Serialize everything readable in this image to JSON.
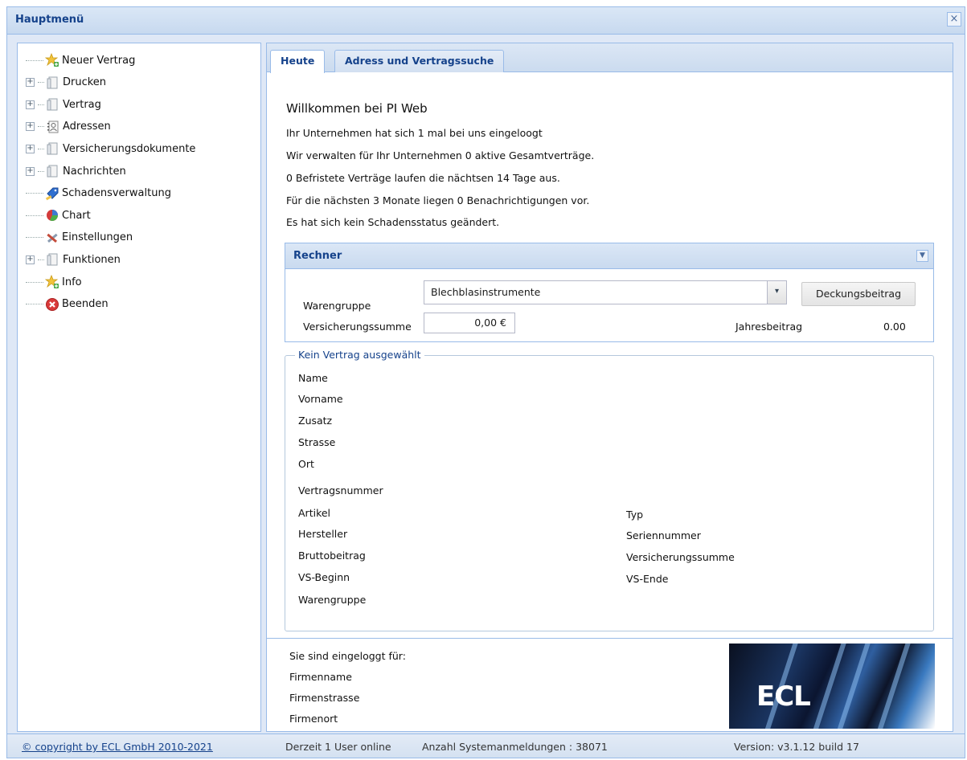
{
  "window": {
    "title": "Hauptmenü",
    "close_label": "×"
  },
  "sidebar": {
    "items": [
      {
        "label": "Neuer Vertrag",
        "icon": "star-add-icon",
        "expandable": false
      },
      {
        "label": "Drucken",
        "icon": "folder-icon",
        "expandable": true
      },
      {
        "label": "Vertrag",
        "icon": "folder-icon",
        "expandable": true
      },
      {
        "label": "Adressen",
        "icon": "address-book-icon",
        "expandable": true
      },
      {
        "label": "Versicherungsdokumente",
        "icon": "folder-icon",
        "expandable": true
      },
      {
        "label": "Nachrichten",
        "icon": "folder-icon",
        "expandable": true
      },
      {
        "label": "Schadensverwaltung",
        "icon": "tag-icon",
        "expandable": false
      },
      {
        "label": "Chart",
        "icon": "pie-chart-icon",
        "expandable": false
      },
      {
        "label": "Einstellungen",
        "icon": "tools-icon",
        "expandable": false
      },
      {
        "label": "Funktionen",
        "icon": "folder-icon",
        "expandable": true
      },
      {
        "label": "Info",
        "icon": "star-add-icon",
        "expandable": false
      },
      {
        "label": "Beenden",
        "icon": "exit-icon",
        "expandable": false
      }
    ]
  },
  "tabs": [
    {
      "label": "Heute",
      "active": true
    },
    {
      "label": "Adress und Vertragssuche",
      "active": false
    }
  ],
  "main": {
    "welcome": "Willkommen bei  PI Web",
    "lines": [
      "Ihr Unternehmen hat sich 1 mal bei uns eingeloogt",
      "Wir verwalten für Ihr Unternehmen 0 aktive Gesamtverträge.",
      "0 Befristete Verträge laufen die nächtsen 14 Tage aus.",
      "Für die nächsten 3 Monate liegen 0 Benachrichtigungen vor.",
      "Es hat sich kein Schadensstatus geändert."
    ]
  },
  "rechner": {
    "title": "Rechner",
    "warengruppe_label": "Warengruppe",
    "warengruppe_value": "Blechblasinstrumente",
    "button_label": "Deckungsbeitrag",
    "versicherungssumme_label": "Versicherungssumme",
    "versicherungssumme_value": "0,00 €",
    "jahresbeitrag_label": "Jahresbeitrag",
    "jahresbeitrag_value": "0.00"
  },
  "vertrag": {
    "legend": "Kein Vertrag ausgewählt",
    "fields_left": [
      "Name",
      "Vorname",
      "Zusatz",
      "Strasse",
      "Ort",
      "Vertragsnummer",
      "Artikel",
      "Hersteller",
      "Bruttobeitrag",
      "VS-Beginn",
      "Warengruppe"
    ],
    "fields_right": [
      "Typ",
      "Seriennummer",
      "Versicherungssumme",
      "VS-Ende"
    ]
  },
  "footer_info": {
    "lines": [
      "Sie sind eingeloggt für:",
      "Firmenname",
      "Firmenstrasse",
      "Firmenort"
    ],
    "logo_text": "ECL"
  },
  "statusbar": {
    "copyright": "© copyright by ECL GmbH 2010-2021",
    "users_online": "Derzeit 1 User online",
    "logins": "Anzahl Systemanmeldungen : 38071",
    "version": "Version: v3.1.12 build 17"
  },
  "colors": {
    "accent": "#15428b",
    "border": "#99bbe8",
    "panel_bg": "#dfe8f6"
  }
}
